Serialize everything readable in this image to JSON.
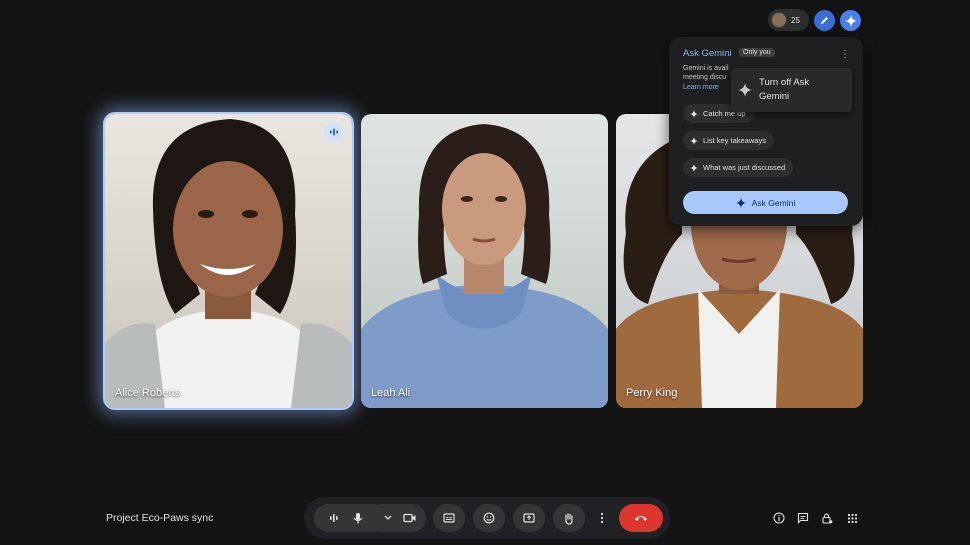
{
  "meeting": {
    "title": "Project Eco-Paws sync"
  },
  "participants": {
    "count": "25",
    "tiles": [
      {
        "name": "Alice Roberts",
        "speaking": true
      },
      {
        "name": "Leah Ali",
        "speaking": false
      },
      {
        "name": "Perry King",
        "speaking": false
      }
    ]
  },
  "gemini_panel": {
    "title": "Ask Gemini",
    "badge": "Only you",
    "description_line1": "Gemini is avail",
    "description_line2": "meeting discu",
    "learn_more": "Learn more",
    "suggestions": [
      "Catch me up",
      "List key takeaways",
      "What was just discussed"
    ],
    "ask_button": "Ask Gemini",
    "menu_item": "Turn off Ask Gemini"
  },
  "icons": {
    "top_bar": [
      "participants-avatar-stack",
      "pen-icon",
      "gemini-sparkle-icon"
    ],
    "controls": [
      "audio-levels-icon",
      "mic-icon",
      "chevron-down-icon",
      "camera-icon",
      "captions-icon",
      "emoji-icon",
      "present-screen-icon",
      "raise-hand-icon",
      "more-options-icon",
      "end-call-icon"
    ],
    "right": [
      "info-icon",
      "chat-icon",
      "host-controls-icon",
      "activities-icon"
    ]
  },
  "colors": {
    "background": "#131314",
    "accent_blue": "#8ab4f8",
    "ask_button": "#a8c7fa",
    "end_call": "#dc362e",
    "speaking_outline": "#aecbfa"
  }
}
